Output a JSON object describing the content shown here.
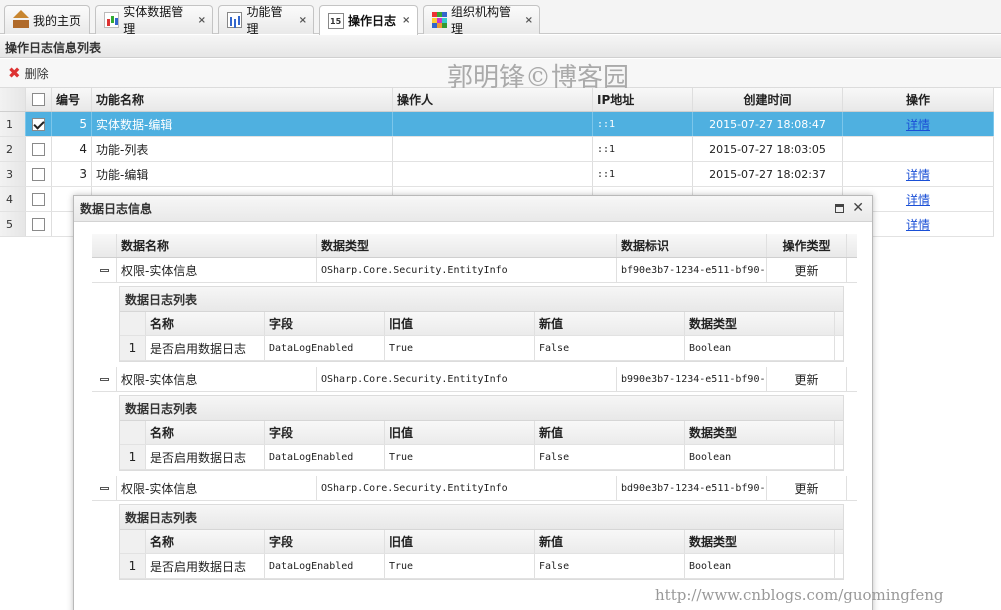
{
  "tabs": [
    {
      "label": "我的主页",
      "icon": "home-icon",
      "closable": false
    },
    {
      "label": "实体数据管理",
      "icon": "chart-icon",
      "closable": true
    },
    {
      "label": "功能管理",
      "icon": "bar-chart-icon",
      "closable": true
    },
    {
      "label": "操作日志",
      "icon": "calendar-icon",
      "closable": true,
      "active": true
    },
    {
      "label": "组织机构管理",
      "icon": "grid-icon",
      "closable": true
    }
  ],
  "tab_close_glyph": "×",
  "panel": {
    "title": "操作日志信息列表"
  },
  "toolbar": {
    "delete_label": "删除",
    "delete_glyph": "✖"
  },
  "watermark": "郭明锋©博客园",
  "url_watermark": "http://www.cnblogs.com/guomingfeng",
  "grid": {
    "columns": [
      "编号",
      "功能名称",
      "操作人",
      "IP地址",
      "创建时间",
      "操作"
    ],
    "rows": [
      {
        "rn": "1",
        "checked": true,
        "id": "5",
        "name": "实体数据-编辑",
        "user": "",
        "ip": "::1",
        "time": "2015-07-27 18:08:47",
        "action": "详情"
      },
      {
        "rn": "2",
        "checked": false,
        "id": "4",
        "name": "功能-列表",
        "user": "",
        "ip": "::1",
        "time": "2015-07-27 18:03:05",
        "action": ""
      },
      {
        "rn": "3",
        "checked": false,
        "id": "3",
        "name": "功能-编辑",
        "user": "",
        "ip": "::1",
        "time": "2015-07-27 18:02:37",
        "action": "详情"
      },
      {
        "rn": "4",
        "checked": false,
        "id": "",
        "name": "",
        "user": "",
        "ip": "",
        "time": "",
        "action": "详情"
      },
      {
        "rn": "5",
        "checked": false,
        "id": "",
        "name": "",
        "user": "",
        "ip": "",
        "time": "",
        "action": "详情"
      }
    ]
  },
  "dialog": {
    "title": "数据日志信息",
    "columns": [
      "数据名称",
      "数据类型",
      "数据标识",
      "操作类型"
    ],
    "sub_title": "数据日志列表",
    "sub_columns": [
      "名称",
      "字段",
      "旧值",
      "新值",
      "数据类型"
    ],
    "entries": [
      {
        "name": "权限-实体信息",
        "type": "OSharp.Core.Security.EntityInfo",
        "key": "bf90e3b7-1234-e511-bf90-",
        "op": "更新",
        "items": [
          {
            "rn": "1",
            "name": "是否启用数据日志",
            "field": "DataLogEnabled",
            "old": "True",
            "new": "False",
            "dtype": "Boolean"
          }
        ]
      },
      {
        "name": "权限-实体信息",
        "type": "OSharp.Core.Security.EntityInfo",
        "key": "b990e3b7-1234-e511-bf90-",
        "op": "更新",
        "items": [
          {
            "rn": "1",
            "name": "是否启用数据日志",
            "field": "DataLogEnabled",
            "old": "True",
            "new": "False",
            "dtype": "Boolean"
          }
        ]
      },
      {
        "name": "权限-实体信息",
        "type": "OSharp.Core.Security.EntityInfo",
        "key": "bd90e3b7-1234-e511-bf90-",
        "op": "更新",
        "items": [
          {
            "rn": "1",
            "name": "是否启用数据日志",
            "field": "DataLogEnabled",
            "old": "True",
            "new": "False",
            "dtype": "Boolean"
          }
        ]
      }
    ]
  }
}
